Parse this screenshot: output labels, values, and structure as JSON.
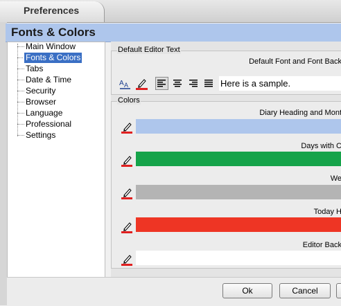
{
  "window": {
    "title": "Preferences"
  },
  "header": {
    "title": "Fonts & Colors"
  },
  "sidebar": {
    "items": [
      {
        "label": "Main Window"
      },
      {
        "label": "Fonts & Colors",
        "selected": true
      },
      {
        "label": "Tabs"
      },
      {
        "label": "Date & Time"
      },
      {
        "label": "Security"
      },
      {
        "label": "Browser"
      },
      {
        "label": "Language"
      },
      {
        "label": "Professional"
      },
      {
        "label": "Settings"
      }
    ]
  },
  "editor_text": {
    "group_label": "Default Editor Text",
    "field_label": "Default Font and Font Back",
    "sample_text": "Here is a sample.",
    "tools": [
      "font-icon",
      "pen-icon",
      "align-left-icon",
      "align-center-icon",
      "align-right-icon",
      "align-justify-icon"
    ]
  },
  "colors": {
    "group_label": "Colors",
    "rows": [
      {
        "label": "Diary Heading and Mont",
        "color": "#aec6ec"
      },
      {
        "label": "Days with C",
        "color": "#16a34a"
      },
      {
        "label": "We",
        "color": "#b4b4b4"
      },
      {
        "label": "Today H",
        "color": "#ee3524"
      },
      {
        "label": "Editor Back",
        "color": "#ffffff"
      }
    ]
  },
  "buttons": {
    "ok": "Ok",
    "cancel": "Cancel"
  }
}
